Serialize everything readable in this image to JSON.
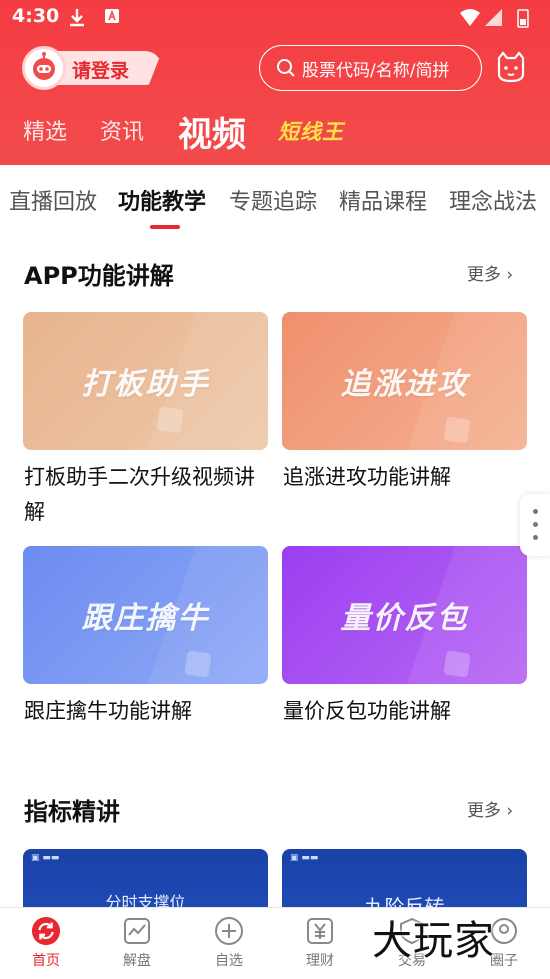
{
  "status_bar": {
    "time": "4:30"
  },
  "header": {
    "login_label": "请登录",
    "search_placeholder": "股票代码/名称/简拼",
    "tabs": [
      {
        "label": "精选"
      },
      {
        "label": "资讯"
      },
      {
        "label": "视频"
      },
      {
        "label": "短线王"
      }
    ]
  },
  "subtabs": [
    {
      "label": "直播回放"
    },
    {
      "label": "功能教学"
    },
    {
      "label": "专题追踪"
    },
    {
      "label": "精品课程"
    },
    {
      "label": "理念战法"
    }
  ],
  "sections": [
    {
      "title": "APP功能讲解",
      "more": "更多",
      "cards": [
        {
          "art": "打板助手",
          "caption": "打板助手二次升级视频讲解"
        },
        {
          "art": "追涨进攻",
          "caption": "追涨进攻功能讲解"
        },
        {
          "art": "跟庄擒牛",
          "caption": "跟庄擒牛功能讲解"
        },
        {
          "art": "量价反包",
          "caption": "量价反包功能讲解"
        }
      ]
    },
    {
      "title": "指标精讲",
      "more": "更多",
      "cards": [
        {
          "art": "分时支撑位"
        },
        {
          "art": "九阶反转"
        }
      ]
    }
  ],
  "bottom_nav": [
    {
      "label": "首页",
      "icon": "refresh-icon",
      "active": true
    },
    {
      "label": "解盘",
      "icon": "chart-icon"
    },
    {
      "label": "自选",
      "icon": "plus-circle-icon"
    },
    {
      "label": "理财",
      "icon": "yuan-icon"
    },
    {
      "label": "交易",
      "icon": "shield-icon"
    },
    {
      "label": "圈子",
      "icon": "community-icon"
    }
  ],
  "watermark": "大玩家",
  "colors": {
    "brand_red": "#f24b4b",
    "accent_yellow": "#ffe24a"
  }
}
